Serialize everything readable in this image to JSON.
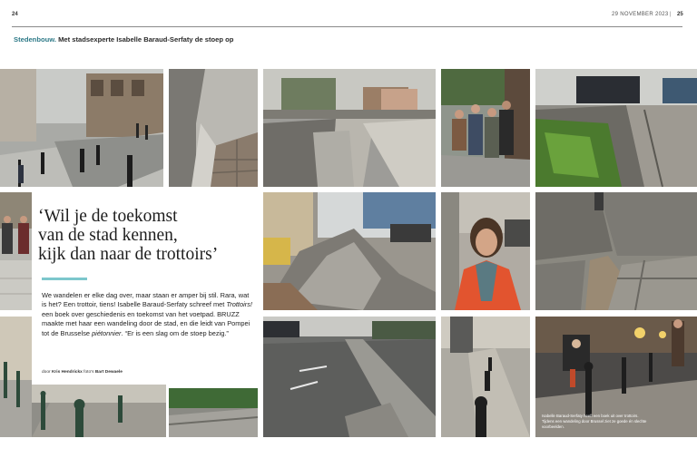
{
  "page": {
    "left_number": "24",
    "date": "29 NOVEMBER 2023",
    "separator": "|",
    "right_number": "25"
  },
  "section": {
    "category": "Stedenbouw.",
    "description": "Met stadsexperte Isabelle Baraud-Serfaty de stoep op"
  },
  "article": {
    "headline_line1": "‘Wil je de toekomst",
    "headline_line2": "van de stad kennen,",
    "headline_line3": "kijk dan naar de trottoirs’",
    "intro_1": "We wandelen er elke dag over, maar staan er amper bij stil. Rara, wat is het? Een trottoir, tiens! Isabelle Baraud-Serfaty schreef met ",
    "book_title": "Trottoirs!",
    "intro_2": " een boek over geschiedenis en toekomst van het voetpad. BRUZZ maakte met haar een wandeling door de stad, en die leidt van Pompei tot de Brusselse ",
    "italic_word": "piétonnier",
    "intro_3": ". “Er is een slag om de stoep bezig.”",
    "byline_by": "door",
    "author": "Kris Hendrickx",
    "byline_photos": "foto's",
    "photographer": "Bart Dewaele"
  },
  "caption": {
    "text": "Isabelle Baraud-Serfaty heeft een boek uit over trottoirs. Tijdens een wandeling door Brussel ziet ze goede én slechte voorbeelden."
  },
  "colors": {
    "accent": "#7cc7cc",
    "section_tag": "#2e7a88",
    "jacket": "#e2542f"
  }
}
